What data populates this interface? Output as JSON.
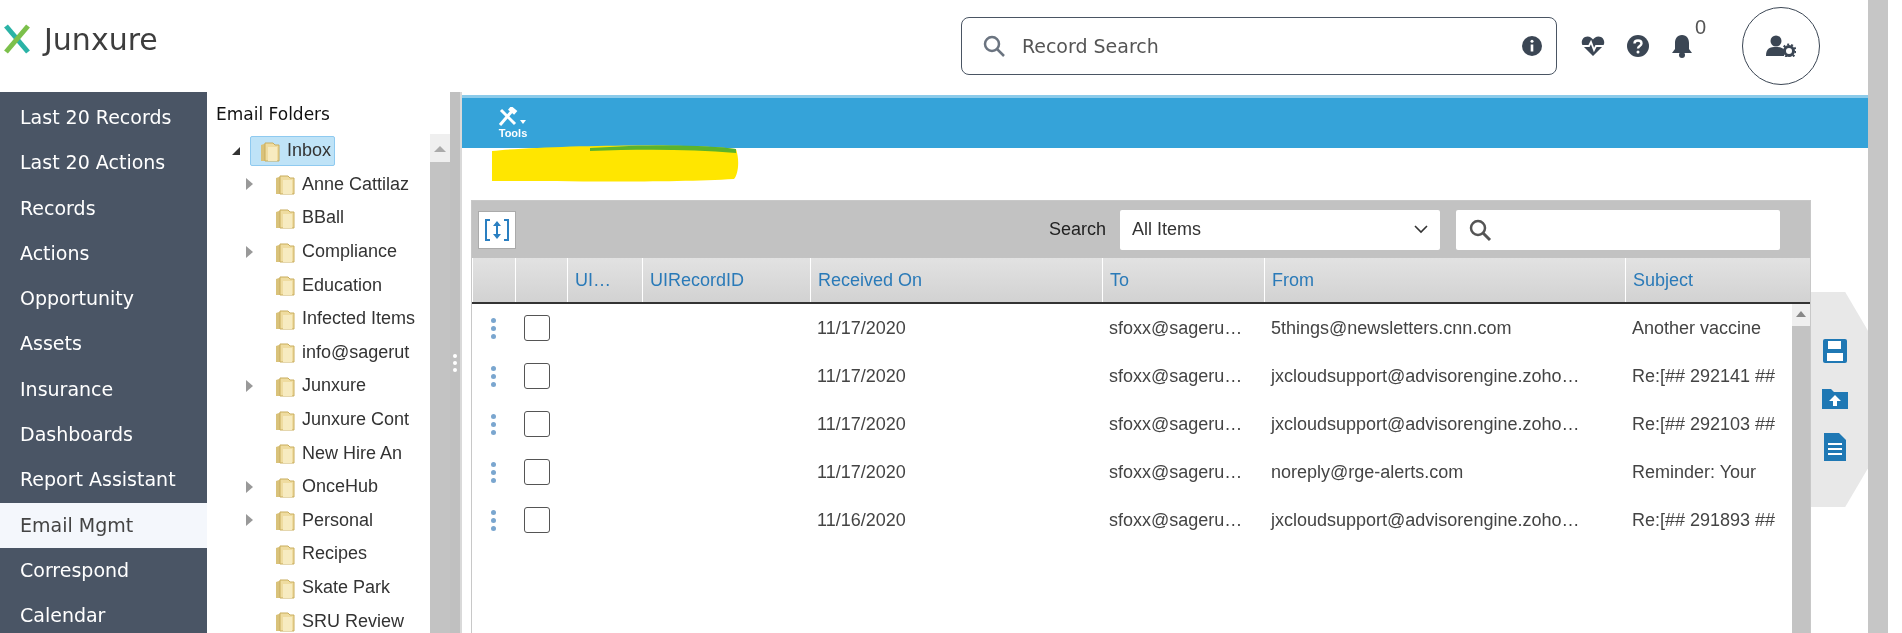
{
  "header": {
    "logo_text": "Junxure",
    "search": {
      "placeholder": "Record Search"
    },
    "notification_count": "0"
  },
  "sidebar": {
    "items": [
      {
        "label": "Last 20 Records",
        "selected": false
      },
      {
        "label": "Last 20 Actions",
        "selected": false
      },
      {
        "label": "Records",
        "selected": false
      },
      {
        "label": "Actions",
        "selected": false
      },
      {
        "label": "Opportunity",
        "selected": false
      },
      {
        "label": "Assets",
        "selected": false
      },
      {
        "label": "Insurance",
        "selected": false
      },
      {
        "label": "Dashboards",
        "selected": false
      },
      {
        "label": "Report Assistant",
        "selected": false
      },
      {
        "label": "Email Mgmt",
        "selected": true
      },
      {
        "label": "Correspond",
        "selected": false
      },
      {
        "label": "Calendar",
        "selected": false
      }
    ]
  },
  "folders": {
    "title": "Email Folders",
    "tree": [
      {
        "label": "Inbox",
        "selected": true,
        "expanded": true,
        "children": [
          {
            "label": "Anne Cattilaz",
            "selected": false,
            "expanded": false
          },
          {
            "label": "BBall",
            "selected": false
          },
          {
            "label": "Compliance",
            "selected": false,
            "expanded": false
          },
          {
            "label": "Education",
            "selected": false
          },
          {
            "label": "Infected Items",
            "selected": false
          },
          {
            "label": "info@sagerut",
            "selected": false
          },
          {
            "label": "Junxure",
            "selected": false,
            "expanded": false
          },
          {
            "label": "Junxure Cont",
            "selected": false
          },
          {
            "label": "New Hire An",
            "selected": false
          },
          {
            "label": "OnceHub",
            "selected": false,
            "expanded": false
          },
          {
            "label": "Personal",
            "selected": false,
            "expanded": false
          },
          {
            "label": "Recipes",
            "selected": false
          },
          {
            "label": "Skate Park",
            "selected": false
          },
          {
            "label": "SRU Review",
            "selected": false
          }
        ]
      }
    ]
  },
  "toolbar": {
    "tools_label": "Tools"
  },
  "grid": {
    "search_label": "Search",
    "filter": "All Items",
    "columns": [
      "UI…",
      "UIRecordID",
      "Received On",
      "To",
      "From",
      "Subject"
    ],
    "rows": [
      {
        "checked": false,
        "cells": [
          "",
          "",
          "11/17/2020",
          "sfoxx@sageru…",
          "5things@newsletters.cnn.com",
          "Another vaccine"
        ]
      },
      {
        "checked": false,
        "cells": [
          "",
          "",
          "11/17/2020",
          "sfoxx@sageru…",
          "jxcloudsupport@advisorengine.zoho…",
          "Re:[## 292141 ##"
        ]
      },
      {
        "checked": false,
        "cells": [
          "",
          "",
          "11/17/2020",
          "sfoxx@sageru…",
          "jxcloudsupport@advisorengine.zoho…",
          "Re:[## 292103 ##"
        ]
      },
      {
        "checked": false,
        "cells": [
          "",
          "",
          "11/17/2020",
          "sfoxx@sageru…",
          "noreply@rge-alerts.com",
          "Reminder: Your"
        ]
      },
      {
        "checked": false,
        "cells": [
          "",
          "",
          "11/16/2020",
          "sfoxx@sageru…",
          "jxcloudsupport@advisorengine.zoho…",
          "Re:[## 291893 ##"
        ]
      }
    ]
  }
}
